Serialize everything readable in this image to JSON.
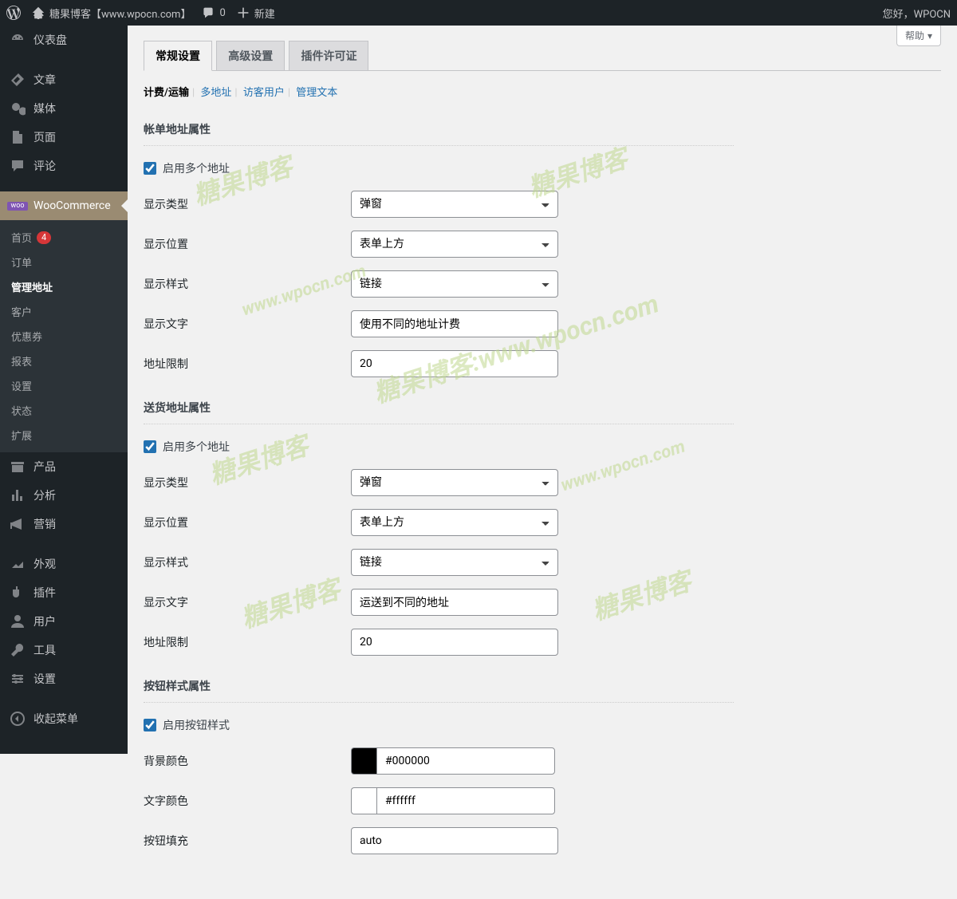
{
  "adminbar": {
    "site_title": "糖果博客【www.wpocn.com】",
    "comments_count": "0",
    "new_label": "新建",
    "greeting": "您好，WPOCN"
  },
  "help_label": "帮助",
  "sidebar": {
    "items": [
      {
        "label": "仪表盘",
        "icon": "dashboard"
      },
      {
        "label": "文章",
        "icon": "post"
      },
      {
        "label": "媒体",
        "icon": "media"
      },
      {
        "label": "页面",
        "icon": "page"
      },
      {
        "label": "评论",
        "icon": "comment"
      },
      {
        "label": "WooCommerce",
        "icon": "woo",
        "current": true
      },
      {
        "label": "产品",
        "icon": "product"
      },
      {
        "label": "分析",
        "icon": "analytics"
      },
      {
        "label": "营销",
        "icon": "marketing"
      },
      {
        "label": "外观",
        "icon": "appearance"
      },
      {
        "label": "插件",
        "icon": "plugins"
      },
      {
        "label": "用户",
        "icon": "users"
      },
      {
        "label": "工具",
        "icon": "tools"
      },
      {
        "label": "设置",
        "icon": "settings"
      },
      {
        "label": "收起菜单",
        "icon": "collapse"
      }
    ],
    "woo_submenu": [
      {
        "label": "首页",
        "badge": "4"
      },
      {
        "label": "订单"
      },
      {
        "label": "管理地址",
        "current": true
      },
      {
        "label": "客户"
      },
      {
        "label": "优惠券"
      },
      {
        "label": "报表"
      },
      {
        "label": "设置"
      },
      {
        "label": "状态"
      },
      {
        "label": "扩展"
      }
    ]
  },
  "tabs": [
    {
      "label": "常规设置",
      "active": true
    },
    {
      "label": "高级设置"
    },
    {
      "label": "插件许可证"
    }
  ],
  "subsub": [
    {
      "label": "计费/运输",
      "current": true
    },
    {
      "label": "多地址"
    },
    {
      "label": "访客用户"
    },
    {
      "label": "管理文本"
    }
  ],
  "sections": {
    "billing": {
      "title": "帐单地址属性",
      "enable_label": "启用多个地址",
      "fields": {
        "display_type": {
          "label": "显示类型",
          "value": "弹窗"
        },
        "display_position": {
          "label": "显示位置",
          "value": "表单上方"
        },
        "display_style": {
          "label": "显示样式",
          "value": "链接"
        },
        "display_text": {
          "label": "显示文字",
          "value": "使用不同的地址计费"
        },
        "address_limit": {
          "label": "地址限制",
          "value": "20"
        }
      }
    },
    "shipping": {
      "title": "送货地址属性",
      "enable_label": "启用多个地址",
      "fields": {
        "display_type": {
          "label": "显示类型",
          "value": "弹窗"
        },
        "display_position": {
          "label": "显示位置",
          "value": "表单上方"
        },
        "display_style": {
          "label": "显示样式",
          "value": "链接"
        },
        "display_text": {
          "label": "显示文字",
          "value": "运送到不同的地址"
        },
        "address_limit": {
          "label": "地址限制",
          "value": "20"
        }
      }
    },
    "button": {
      "title": "按钮样式属性",
      "enable_label": "启用按钮样式",
      "fields": {
        "bg_color": {
          "label": "背景颜色",
          "value": "#000000"
        },
        "text_color": {
          "label": "文字颜色",
          "value": "#ffffff"
        },
        "padding": {
          "label": "按钮填充",
          "value": "auto"
        }
      }
    }
  },
  "watermarks": [
    "糖果博客",
    "糖果博客",
    "糖果博客:www.wpocn.com",
    "www.wpocn.com",
    "www.wpocn.com",
    "糖果博客",
    "糖果博客"
  ]
}
